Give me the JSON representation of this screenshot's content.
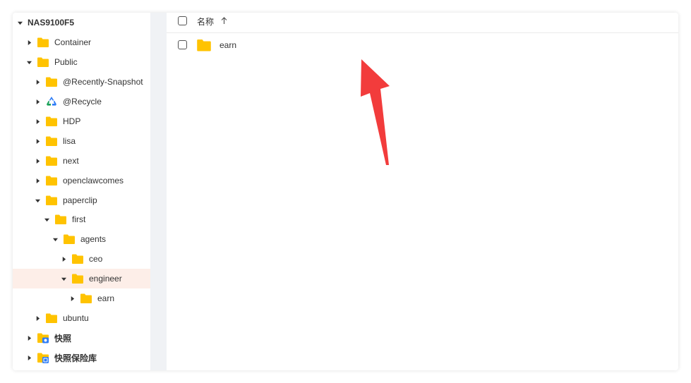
{
  "tree": {
    "items": [
      {
        "label": "NAS9100F5",
        "expanded": true,
        "icon": "none",
        "bold": true
      },
      {
        "label": "Container",
        "expanded": false,
        "icon": "folder-icon"
      },
      {
        "label": "Public",
        "expanded": true,
        "icon": "folder-icon"
      },
      {
        "label": "@Recently-Snapshot",
        "expanded": false,
        "icon": "folder-icon"
      },
      {
        "label": "@Recycle",
        "expanded": false,
        "icon": "recycle-icon"
      },
      {
        "label": "HDP",
        "expanded": false,
        "icon": "folder-icon"
      },
      {
        "label": "lisa",
        "expanded": false,
        "icon": "folder-icon"
      },
      {
        "label": "next",
        "expanded": false,
        "icon": "folder-icon"
      },
      {
        "label": "openclawcomes",
        "expanded": false,
        "icon": "folder-icon"
      },
      {
        "label": "paperclip",
        "expanded": true,
        "icon": "folder-icon"
      },
      {
        "label": "first",
        "expanded": true,
        "icon": "folder-icon"
      },
      {
        "label": "agents",
        "expanded": true,
        "icon": "folder-icon"
      },
      {
        "label": "ceo",
        "expanded": false,
        "icon": "folder-icon"
      },
      {
        "label": "engineer",
        "expanded": true,
        "icon": "folder-icon",
        "selected": true
      },
      {
        "label": "earn",
        "expanded": false,
        "icon": "folder-icon"
      },
      {
        "label": "ubuntu",
        "expanded": false,
        "icon": "folder-icon"
      },
      {
        "label": "快照",
        "expanded": false,
        "icon": "snapshot-folder-icon",
        "bold": true
      },
      {
        "label": "快照保险库",
        "expanded": false,
        "icon": "vault-folder-icon",
        "bold": true
      }
    ]
  },
  "list": {
    "header": {
      "name_label": "名称",
      "sort": "ascending"
    },
    "rows": [
      {
        "name": "earn",
        "type": "folder"
      }
    ]
  },
  "colors": {
    "folder": "#FFC300",
    "selected_row": "#fdeee8",
    "annotation_arrow": "#F23C3C"
  }
}
